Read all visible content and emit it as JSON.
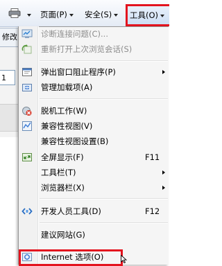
{
  "command_bar": {
    "page_label": "页面(P)",
    "safety_label": "安全(S)",
    "tools_label": "工具(O)",
    "highlight_color": "#e3131e"
  },
  "background": {
    "tab_text": "修改",
    "field_text": "1"
  },
  "menu": {
    "items": [
      {
        "label": "诊断连接问题(C)...",
        "disabled": true,
        "icon": "diagnose-icon"
      },
      {
        "label": "重新打开上次浏览会话(S)",
        "disabled": true,
        "icon": "reopen-session-icon"
      },
      {
        "label": "弹出窗口阻止程序(P)",
        "submenu": true,
        "icon": "popup-blocker-icon"
      },
      {
        "label": "管理加载项(A)",
        "icon": "manage-addons-icon"
      },
      {
        "label": "脱机工作(W)",
        "icon": "work-offline-icon"
      },
      {
        "label": "兼容性视图(V)",
        "icon": "compatibility-view-icon"
      },
      {
        "label": "兼容性视图设置(B)"
      },
      {
        "label": "全屏显示(F)",
        "shortcut": "F11",
        "icon": "fullscreen-icon"
      },
      {
        "label": "工具栏(T)",
        "submenu": true
      },
      {
        "label": "浏览器栏(X)",
        "submenu": true
      },
      {
        "label": "开发人员工具(D)",
        "shortcut": "F12",
        "icon": "developer-tools-icon"
      },
      {
        "label": "建议网站(G)"
      },
      {
        "label": "Internet 选项(O)",
        "icon": "internet-options-icon"
      }
    ]
  }
}
